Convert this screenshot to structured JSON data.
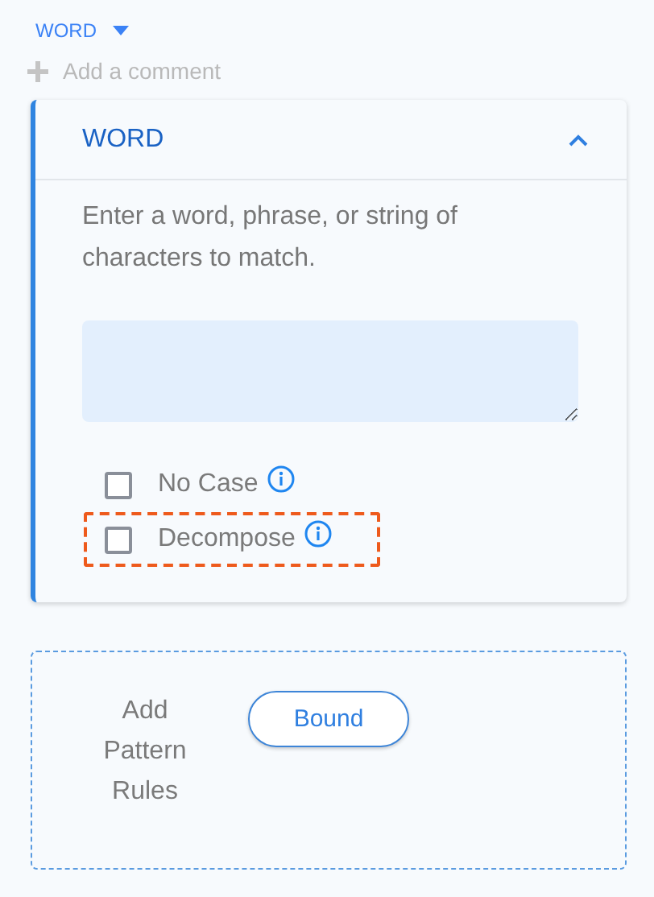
{
  "type_selector": {
    "label": "WORD"
  },
  "add_comment": {
    "label": "Add a comment"
  },
  "card": {
    "title": "WORD",
    "expanded": true,
    "description": "Enter a word, phrase, or string of characters to match.",
    "options": [
      {
        "label": "No Case",
        "checked": false,
        "focused": false
      },
      {
        "label": "Decompose",
        "checked": false,
        "focused": true
      }
    ]
  },
  "pattern_rules": {
    "label": "Add Pattern Rules",
    "buttons": [
      "Bound"
    ]
  }
}
